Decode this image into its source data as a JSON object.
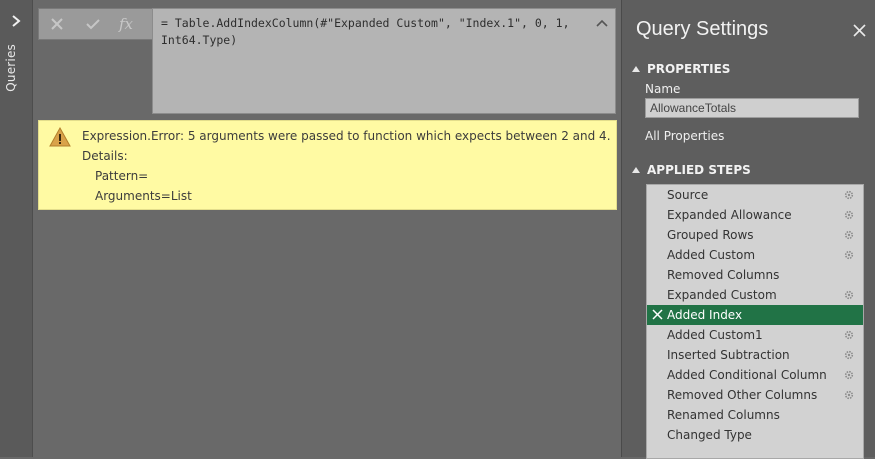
{
  "queries_rail": {
    "label": "Queries"
  },
  "formula_bar": {
    "fx_label": "fx",
    "formula": "= Table.AddIndexColumn(#\"Expanded Custom\", \"Index.1\", 0, 1,\nInt64.Type)"
  },
  "error": {
    "message": "Expression.Error: 5 arguments were passed to function which expects between 2 and 4.",
    "details_label": "Details:",
    "pattern_label": "Pattern=",
    "arguments_label": "Arguments=List"
  },
  "query_settings": {
    "title": "Query Settings",
    "properties_heading": "PROPERTIES",
    "name_label": "Name",
    "name_value": "AllowanceTotals",
    "all_properties": "All Properties",
    "applied_steps_heading": "APPLIED STEPS",
    "steps": [
      {
        "label": "Source",
        "gear": true
      },
      {
        "label": "Expanded Allowance",
        "gear": true
      },
      {
        "label": "Grouped Rows",
        "gear": true
      },
      {
        "label": "Added Custom",
        "gear": true
      },
      {
        "label": "Removed Columns",
        "gear": false
      },
      {
        "label": "Expanded Custom",
        "gear": true
      },
      {
        "label": "Added Index",
        "gear": false,
        "selected": true,
        "error": true
      },
      {
        "label": "Added Custom1",
        "gear": true
      },
      {
        "label": "Inserted Subtraction",
        "gear": true
      },
      {
        "label": "Added Conditional Column",
        "gear": true
      },
      {
        "label": "Removed Other Columns",
        "gear": true
      },
      {
        "label": "Renamed Columns",
        "gear": false
      },
      {
        "label": "Changed Type",
        "gear": false
      }
    ]
  },
  "colors": {
    "background": "#696969",
    "error_panel": "#fffaa3",
    "selected_step": "#217346"
  }
}
